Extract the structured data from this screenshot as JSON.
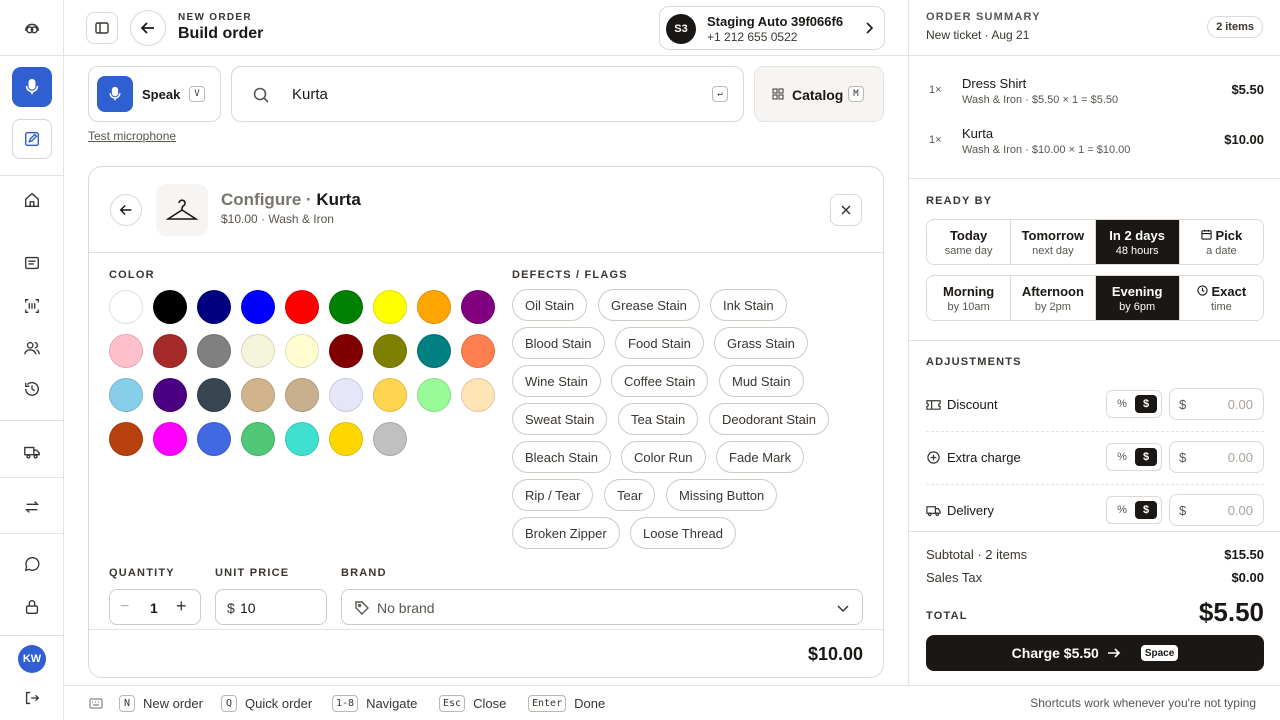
{
  "header": {
    "overline": "NEW ORDER",
    "title": "Build order",
    "customer": {
      "initials": "S3",
      "name": "Staging Auto 39f066f6",
      "phone": "+1 212 655 0522"
    }
  },
  "input_bar": {
    "speak_label": "Speak",
    "speak_key": "V",
    "search_value": "Kurta",
    "search_key": "↵",
    "catalog_label": "Catalog",
    "catalog_key": "M",
    "test_mic": "Test microphone"
  },
  "configure": {
    "prefix": "Configure · ",
    "item": "Kurta",
    "subtitle": "$10.00 · Wash & Iron",
    "color_label": "COLOR",
    "colors": [
      "#ffffff",
      "#000000",
      "#000080",
      "#0000ff",
      "#ff0000",
      "#008000",
      "#ffff00",
      "#ffa500",
      "#800080",
      "#ffc0cb",
      "#a52a2a",
      "#808080",
      "#f5f5dc",
      "#fffdd0",
      "#800000",
      "#808000",
      "#008080",
      "#ff7f50",
      "#87ceeb",
      "#4b0082",
      "#36454f",
      "#d2b48c",
      "#c8b08e",
      "#e6e6fa",
      "#ffd54f",
      "#98fb98",
      "#ffe4b5",
      "#b7410e",
      "#ff00ff",
      "#4169e1",
      "#50c878",
      "#40e0d0",
      "#ffd700",
      "#c0c0c0"
    ],
    "flags_label": "DEFECTS / FLAGS",
    "flags": [
      [
        "Oil Stain",
        "Grease Stain",
        "Ink Stain"
      ],
      [
        "Blood Stain",
        "Food Stain",
        "Grass Stain"
      ],
      [
        "Wine Stain",
        "Coffee Stain",
        "Mud Stain"
      ],
      [
        "Sweat Stain",
        "Tea Stain",
        "Deodorant Stain"
      ],
      [
        "Bleach Stain",
        "Color Run",
        "Fade Mark"
      ],
      [
        "Rip / Tear",
        "Tear",
        "Missing Button"
      ],
      [
        "Broken Zipper",
        "Loose Thread"
      ]
    ],
    "quantity_label": "QUANTITY",
    "quantity": "1",
    "unit_price_label": "UNIT PRICE",
    "currency": "$",
    "unit_price": "10",
    "brand_label": "BRAND",
    "brand_value": "No brand",
    "line_total": "$10.00"
  },
  "footer": {
    "shortcuts": [
      {
        "key": "N",
        "label": "New order"
      },
      {
        "key": "Q",
        "label": "Quick order"
      },
      {
        "key": "1-8",
        "label": "Navigate"
      },
      {
        "key": "Esc",
        "label": "Close"
      },
      {
        "key": "Enter",
        "label": "Done"
      }
    ],
    "hint": "Shortcuts work whenever you're not typing"
  },
  "summary": {
    "title": "ORDER SUMMARY",
    "ticket": "New ticket · Aug 21",
    "count_badge": "2 items",
    "lines": [
      {
        "qty": "1×",
        "name": "Dress Shirt",
        "detail": "Wash & Iron · $5.50 × 1 = $5.50",
        "amount": "$5.50"
      },
      {
        "qty": "1×",
        "name": "Kurta",
        "detail": "Wash & Iron · $10.00 × 1 = $10.00",
        "amount": "$10.00"
      }
    ],
    "ready_label": "READY BY",
    "days": [
      {
        "t": "Today",
        "s": "same day",
        "selected": false
      },
      {
        "t": "Tomorrow",
        "s": "next day",
        "selected": false
      },
      {
        "t": "In 2 days",
        "s": "48 hours",
        "selected": true
      },
      {
        "t": "Pick",
        "s": "a date",
        "selected": false,
        "icon": "calendar-icon"
      }
    ],
    "times": [
      {
        "t": "Morning",
        "s": "by 10am",
        "selected": false
      },
      {
        "t": "Afternoon",
        "s": "by 2pm",
        "selected": false
      },
      {
        "t": "Evening",
        "s": "by 6pm",
        "selected": true
      },
      {
        "t": "Exact",
        "s": "time",
        "selected": false,
        "icon": "clock-icon"
      }
    ],
    "adjustments_label": "ADJUSTMENTS",
    "adjustments": [
      {
        "label": "Discount",
        "icon": "ticket-icon",
        "pct": "%",
        "dollar": "$",
        "currency": "$",
        "placeholder": "0.00"
      },
      {
        "label": "Extra charge",
        "icon": "plus-circle-icon",
        "pct": "%",
        "dollar": "$",
        "currency": "$",
        "placeholder": "0.00"
      },
      {
        "label": "Delivery",
        "icon": "truck-icon",
        "pct": "%",
        "dollar": "$",
        "currency": "$",
        "placeholder": "0.00"
      }
    ],
    "subtotal_label": "Subtotal · 2 items",
    "subtotal": "$15.50",
    "tax_label": "Sales Tax",
    "tax": "$0.00",
    "total_label": "TOTAL",
    "total": "$5.50",
    "charge_label": "Charge $5.50",
    "charge_key": "Space"
  }
}
